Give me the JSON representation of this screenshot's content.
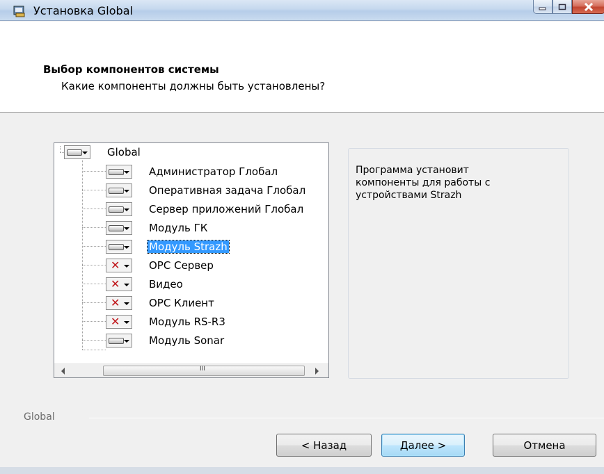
{
  "window": {
    "title": "Установка Global"
  },
  "header": {
    "title": "Выбор компонентов системы",
    "subtitle": "Какие компоненты должны быть установлены?"
  },
  "tree": {
    "root": {
      "label": "Global",
      "state": "install"
    },
    "items": [
      {
        "label": "Администратор Глобал",
        "state": "install",
        "selected": false
      },
      {
        "label": "Оперативная задача Глобал",
        "state": "install",
        "selected": false
      },
      {
        "label": "Сервер приложений Глобал",
        "state": "install",
        "selected": false
      },
      {
        "label": "Модуль ГК",
        "state": "install",
        "selected": false
      },
      {
        "label": "Модуль Strazh",
        "state": "install",
        "selected": true
      },
      {
        "label": "OPC Сервер",
        "state": "excluded",
        "selected": false
      },
      {
        "label": "Видео",
        "state": "excluded",
        "selected": false
      },
      {
        "label": "OPC Клиент",
        "state": "excluded",
        "selected": false
      },
      {
        "label": "Модуль RS-R3",
        "state": "excluded",
        "selected": false
      },
      {
        "label": "Модуль Sonar",
        "state": "install",
        "selected": false
      }
    ],
    "scroll_grip": "III"
  },
  "description": {
    "text": "Программа установит компоненты для работы с устройствами Strazh"
  },
  "footer": {
    "brand": "Global",
    "back_label": "< Назад",
    "next_label": "Далее >",
    "cancel_label": "Отмена"
  },
  "icons": {
    "install": "drive-icon",
    "excluded": "red-x-icon"
  },
  "colors": {
    "selection": "#3399ff",
    "excluded_x": "#c0181d"
  }
}
